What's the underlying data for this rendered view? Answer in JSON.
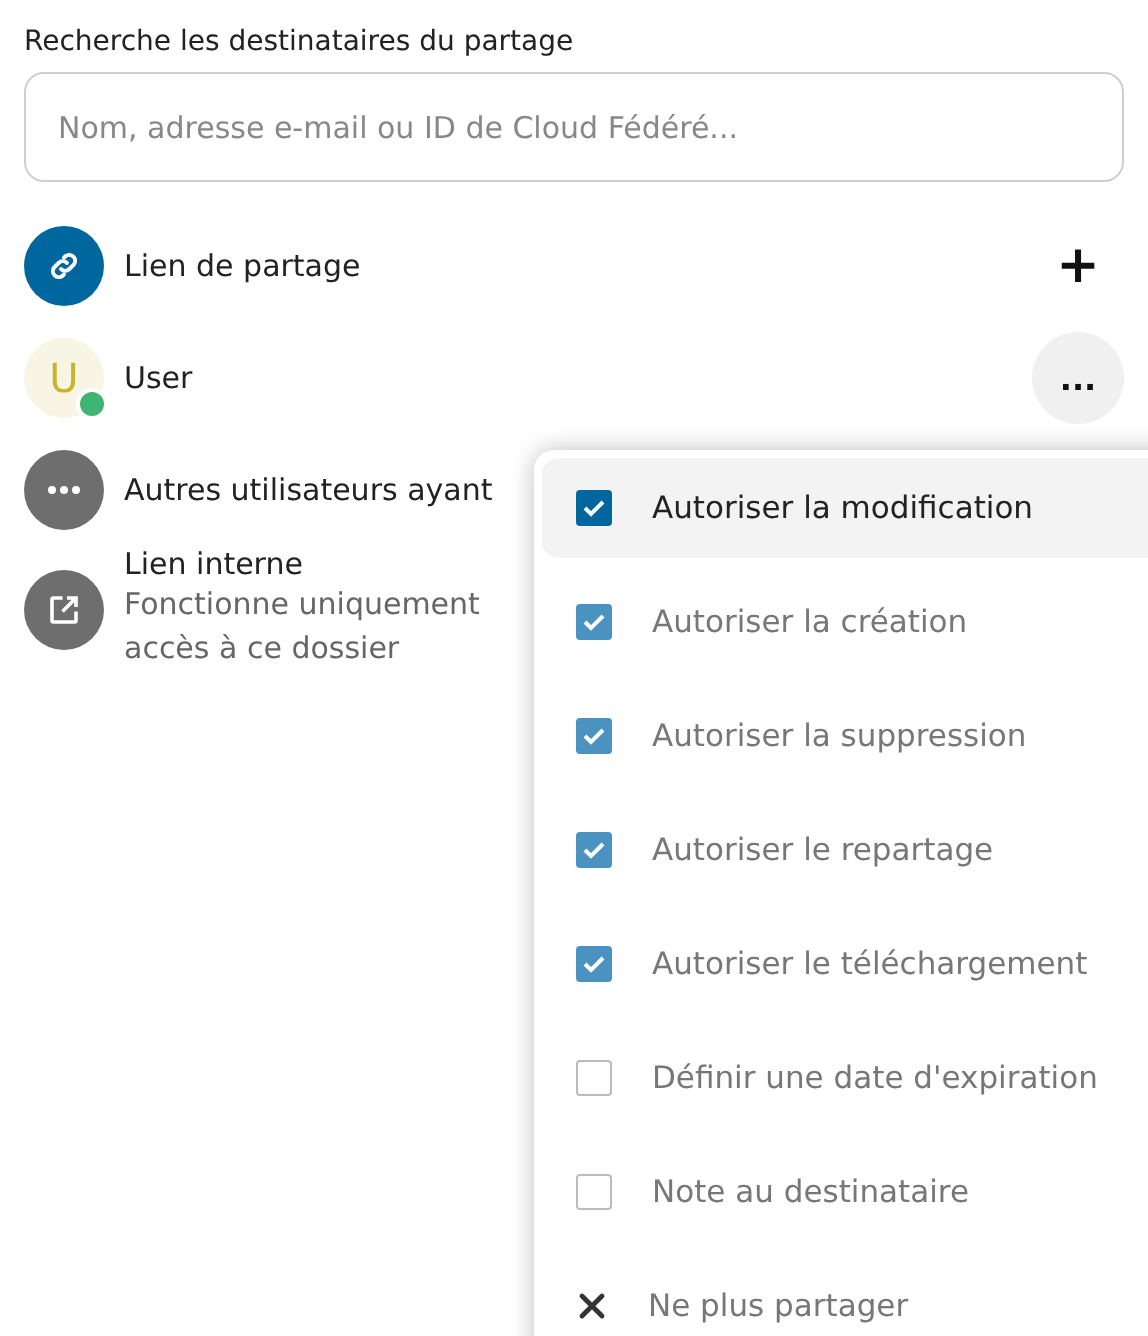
{
  "search": {
    "label": "Recherche les destinataires du partage",
    "placeholder": "Nom, adresse e-mail ou ID de Cloud Fédéré..."
  },
  "shares": [
    {
      "kind": "link",
      "title": "Lien de partage",
      "action": "+"
    },
    {
      "kind": "user",
      "initial": "U",
      "title": "User",
      "online": true,
      "action": "...",
      "action_hovered": true
    },
    {
      "kind": "others",
      "title": "Autres utilisateurs ayant"
    },
    {
      "kind": "internal",
      "title": "Lien interne",
      "subtitle": "Fonctionne uniquement\naccès à ce dossier"
    }
  ],
  "menu": [
    {
      "kind": "checkbox",
      "label": "Autoriser la modification",
      "checked": true,
      "highlighted": true
    },
    {
      "kind": "checkbox",
      "label": "Autoriser la création",
      "checked": true,
      "highlighted": false
    },
    {
      "kind": "checkbox",
      "label": "Autoriser la suppression",
      "checked": true,
      "highlighted": false
    },
    {
      "kind": "checkbox",
      "label": "Autoriser le repartage",
      "checked": true,
      "highlighted": false
    },
    {
      "kind": "checkbox",
      "label": "Autoriser le téléchargement",
      "checked": true,
      "highlighted": false
    },
    {
      "kind": "checkbox",
      "label": "Définir une date d'expiration",
      "checked": false,
      "highlighted": false
    },
    {
      "kind": "checkbox",
      "label": "Note au destinataire",
      "checked": false,
      "highlighted": false
    },
    {
      "kind": "action",
      "label": "Ne plus partager",
      "highlighted": false
    }
  ]
}
